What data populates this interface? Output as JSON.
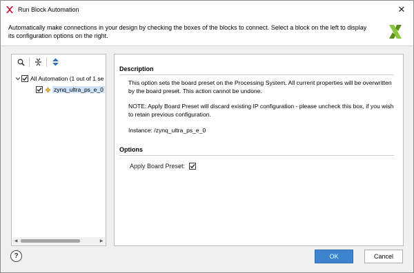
{
  "window": {
    "title": "Run Block Automation",
    "close_glyph": "✕",
    "app_icon": "xilinx-logo-icon"
  },
  "header": {
    "description": "Automatically make connections in your design by checking the boxes of the blocks to connect. Select a block on the left to display its configuration options on the right.",
    "brand_icon": "xilinx-logo-icon"
  },
  "tree": {
    "toolbar": [
      {
        "icon": "search-icon"
      },
      {
        "icon": "collapse-all-icon"
      },
      {
        "icon": "expand-all-icon"
      }
    ],
    "items": [
      {
        "label": "All Automation (1 out of 1 se",
        "checked": true,
        "expanded": true,
        "level": 0
      },
      {
        "label": "zynq_ultra_ps_e_0",
        "checked": true,
        "selected": true,
        "level": 1,
        "icon": "ip-block-icon"
      }
    ]
  },
  "details": {
    "description_heading": "Description",
    "description_text": "This option sets the board preset on the Processing System. All current properties will be overwritten by the board preset. This action cannot be undone.",
    "note_text": "NOTE: Apply Board Preset will discard existing IP configuration - please uncheck this box, if you wish to retain previous configuration.",
    "instance_text": "Instance: /zynq_ultra_ps_e_0",
    "options_heading": "Options",
    "apply_board_preset_label": "Apply Board Preset:",
    "apply_board_preset_checked": true
  },
  "footer": {
    "help_glyph": "?",
    "ok_label": "OK",
    "cancel_label": "Cancel"
  },
  "colors": {
    "accent": "#3d83ce",
    "selection": "#cde3f7"
  }
}
